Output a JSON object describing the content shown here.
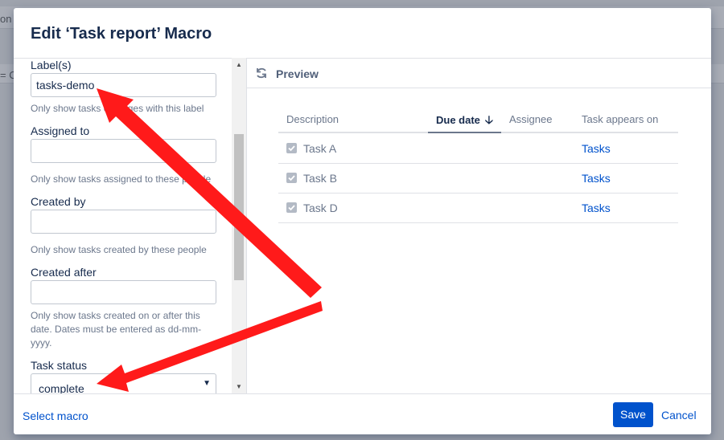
{
  "background": {
    "fragment_top": "on",
    "fragment_second": "= C"
  },
  "modal": {
    "title": "Edit ‘Task report’ Macro",
    "fields": {
      "labels": {
        "label": "Label(s)",
        "value": "tasks-demo",
        "help": "Only show tasks on pages with this label"
      },
      "assigned_to": {
        "label": "Assigned to",
        "value": "",
        "help": "Only show tasks assigned to these people"
      },
      "created_by": {
        "label": "Created by",
        "value": "",
        "help": "Only show tasks created by these people"
      },
      "created_after": {
        "label": "Created after",
        "value": "",
        "help": "Only show tasks created on or after this date. Dates must be entered as dd-mm-yyyy."
      },
      "task_status": {
        "label": "Task status",
        "value": "complete"
      }
    },
    "preview": {
      "label": "Preview",
      "columns": [
        "Description",
        "Due date",
        "Assignee",
        "Task appears on"
      ],
      "sorted_column": "Due date",
      "rows": [
        {
          "description": "Task A",
          "due_date": "",
          "assignee": "",
          "appears_on": "Tasks",
          "checked": true
        },
        {
          "description": "Task B",
          "due_date": "",
          "assignee": "",
          "appears_on": "Tasks",
          "checked": true
        },
        {
          "description": "Task D",
          "due_date": "",
          "assignee": "",
          "appears_on": "Tasks",
          "checked": true
        }
      ]
    },
    "footer": {
      "select_macro": "Select macro",
      "save": "Save",
      "cancel": "Cancel"
    }
  },
  "colors": {
    "primary": "#0052cc",
    "annotation": "#ff0000"
  },
  "icons": {
    "refresh": "refresh-icon",
    "sort": "arrow-down-icon",
    "checkbox": "checkbox-checked-icon"
  }
}
